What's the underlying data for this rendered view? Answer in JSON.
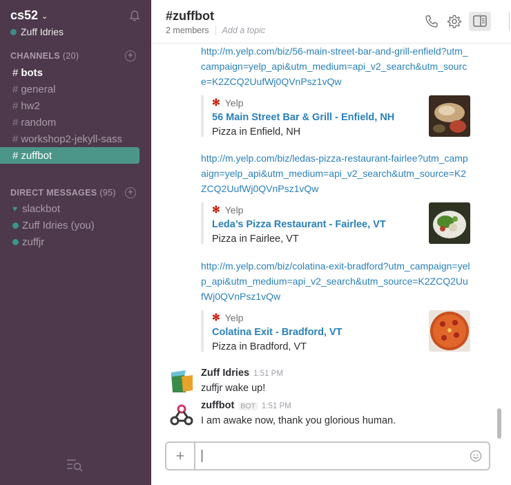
{
  "team": {
    "name": "cs52",
    "user": "Zuff Idries"
  },
  "sidebar": {
    "channels_label": "CHANNELS",
    "channels_count": "(20)",
    "channels": [
      {
        "name": "bots"
      },
      {
        "name": "general"
      },
      {
        "name": "hw2"
      },
      {
        "name": "random"
      },
      {
        "name": "workshop2-jekyll-sass"
      },
      {
        "name": "zuffbot"
      }
    ],
    "dm_label": "DIRECT MESSAGES",
    "dm_count": "(95)",
    "dms": [
      {
        "name": "slackbot",
        "icon": "heart-icon"
      },
      {
        "name": "Zuff Idries (you)",
        "icon": "presence-dot"
      },
      {
        "name": "zuffjr",
        "icon": "presence-dot"
      }
    ]
  },
  "header": {
    "channel": "#zuffbot",
    "members": "2 members",
    "topic_placeholder": "Add a topic"
  },
  "results": [
    {
      "url": "http://m.yelp.com/biz/56-main-street-bar-and-grill-enfield?utm_campaign=yelp_api&utm_medium=api_v2_search&utm_source=K2ZCQ2UufWj0QVnPsz1vQw",
      "service": "Yelp",
      "title": "56 Main Street Bar & Grill - Enfield, NH",
      "text": "Pizza in Enfield, NH"
    },
    {
      "url": "http://m.yelp.com/biz/ledas-pizza-restaurant-fairlee?utm_campaign=yelp_api&utm_medium=api_v2_search&utm_source=K2ZCQ2UufWj0QVnPsz1vQw",
      "service": "Yelp",
      "title": "Leda’s Pizza Restaurant - Fairlee, VT",
      "text": "Pizza in Fairlee, VT"
    },
    {
      "url": "http://m.yelp.com/biz/colatina-exit-bradford?utm_campaign=yelp_api&utm_medium=api_v2_search&utm_source=K2ZCQ2UufWj0QVnPsz1vQw",
      "service": "Yelp",
      "title": "Colatina Exit - Bradford, VT",
      "text": "Pizza in Bradford, VT"
    }
  ],
  "messages": [
    {
      "sender": "Zuff Idries",
      "time": "1:51 PM",
      "text": "zuffjr wake up!"
    },
    {
      "sender": "zuffbot",
      "badge": "BOT",
      "time": "1:51 PM",
      "text": "I am awake now, thank you glorious human."
    }
  ],
  "colors": {
    "sidebar": "#4d394b",
    "active": "#4c9689",
    "link": "#2a80b9",
    "presence": "#38978d"
  }
}
